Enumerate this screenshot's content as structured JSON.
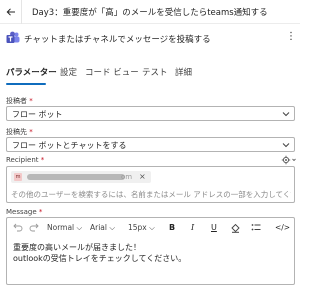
{
  "breadcrumb": {
    "text": "Day3：重要度が「高」のメールを受信したらteams通知する"
  },
  "action": {
    "title": "チャットまたはチャネルでメッセージを投稿する"
  },
  "tabs": [
    {
      "label": "パラメーター"
    },
    {
      "label": "設定"
    },
    {
      "label": "コード ビュー"
    },
    {
      "label": "テスト"
    },
    {
      "label": "詳細"
    }
  ],
  "fields": {
    "post_as": {
      "label": "投稿者",
      "required": "*",
      "value": "フロー ボット"
    },
    "post_in": {
      "label": "投稿先",
      "required": "*",
      "value": "フロー ボットとチャットをする"
    },
    "recipient": {
      "label": "Recipient",
      "required": "*",
      "chip_text": "m",
      "chip_suffix": "om",
      "chip_close": "×",
      "placeholder": "その他のユーザーを検索するには、名前またはメール アドレスの一部を入力してくだ:"
    },
    "message": {
      "label": "Message",
      "required": "*",
      "toolbar": {
        "style": "Normal",
        "font": "Arial",
        "size": "15px",
        "bold": "B",
        "italic": "I",
        "underline": "U",
        "code": "</>"
      },
      "lines": [
        "重要度の高いメールが届きました！",
        "outlookの受信トレイをチェックしてください。"
      ]
    }
  },
  "colors": {
    "accent": "#0f6cbd",
    "required": "#c50f1f",
    "teams": "#5b5fc7"
  }
}
